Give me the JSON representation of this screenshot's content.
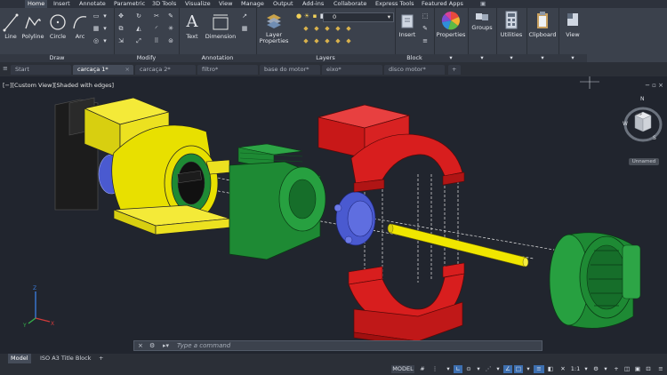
{
  "menu_tabs": [
    "Home",
    "Insert",
    "Annotate",
    "Parametric",
    "3D Tools",
    "Visualize",
    "View",
    "Manage",
    "Output",
    "Add-ins",
    "Collaborate",
    "Express Tools",
    "Featured Apps"
  ],
  "ribbon": {
    "draw": {
      "label": "Draw",
      "tools": [
        "Line",
        "Polyline",
        "Circle",
        "Arc"
      ]
    },
    "modify": {
      "label": "Modify"
    },
    "annotation": {
      "label": "Annotation",
      "tools": [
        "Text",
        "Dimension"
      ]
    },
    "layers": {
      "label": "Layers",
      "tool": "Layer Properties",
      "current_layer": "0"
    },
    "block": {
      "label": "Block",
      "tool": "Insert"
    },
    "properties": {
      "label": "Properties"
    },
    "groups": {
      "label": "Groups"
    },
    "utilities": {
      "label": "Utilities"
    },
    "clipboard": {
      "label": "Clipboard"
    },
    "view": {
      "label": "View"
    }
  },
  "doc_tabs": [
    "Start",
    "carcaça 1*",
    "carcaça 2*",
    "filtro*",
    "base do motor*",
    "eixo*",
    "disco motor*"
  ],
  "viewport": {
    "label": "[−][Custom View][Shaded with edges]"
  },
  "viewcube": {
    "north": "N",
    "west": "W",
    "south": "S",
    "top": "TOP",
    "badge": "Unnamed"
  },
  "command": {
    "placeholder": "Type a command"
  },
  "layout_tabs": [
    "Model",
    "ISO A3 Title Block"
  ],
  "status": {
    "model": "MODEL",
    "scale": "1:1"
  },
  "colors": {
    "yellow": "#e8e000",
    "green": "#1e8a34",
    "red": "#d81e1e",
    "blue": "#4a5ad0",
    "black": "#1c1c1c",
    "shaft": "#f0e600"
  }
}
